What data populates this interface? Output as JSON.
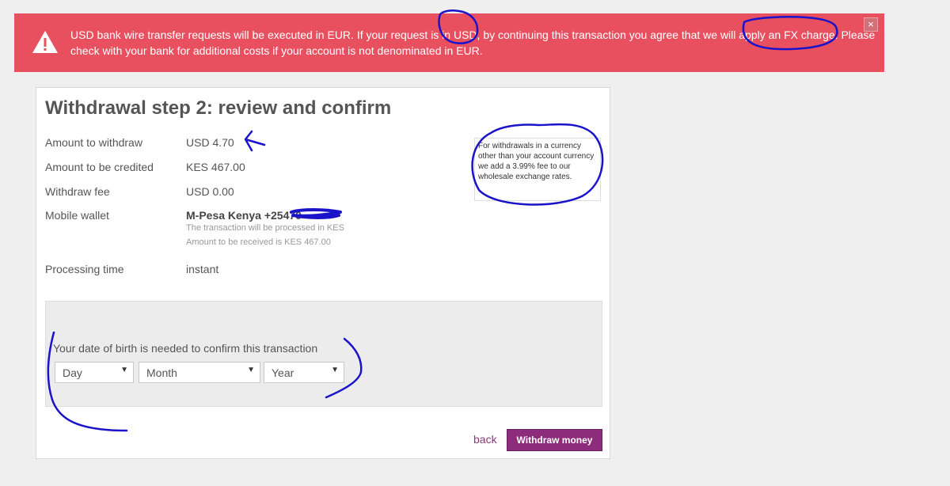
{
  "alert": {
    "message": "USD bank wire transfer requests will be executed in EUR. If your request is in USD, by continuing this transaction you agree that we will apply an FX charge. Please check with your bank for additional costs if your account is not denominated in EUR.",
    "close_icon": "×"
  },
  "panel": {
    "title": "Withdrawal step 2: review and confirm",
    "rows": [
      {
        "label": "Amount to withdraw",
        "value": "USD 4.70"
      },
      {
        "label": "Amount to be credited",
        "value": "KES 467.00"
      },
      {
        "label": "Withdraw fee",
        "value": "USD 0.00"
      }
    ],
    "wallet": {
      "label": "Mobile wallet",
      "name": "M-Pesa Kenya +25470",
      "note1": "The transaction will be processed in KES",
      "note2": "Amount to be received is KES 467.00"
    },
    "processing": {
      "label": "Processing time",
      "value": "instant"
    },
    "tooltip": "For withdrawals in a currency other than your account currency we add a 3.99% fee to our wholesale exchange rates."
  },
  "dob": {
    "label": "Your date of birth is needed to confirm this transaction",
    "day": "Day",
    "month": "Month",
    "year": "Year"
  },
  "actions": {
    "back": "back",
    "submit": "Withdraw money"
  },
  "colors": {
    "alert_bg": "#e8505f",
    "button": "#8e2c7c",
    "annotation": "#1a13c9"
  }
}
